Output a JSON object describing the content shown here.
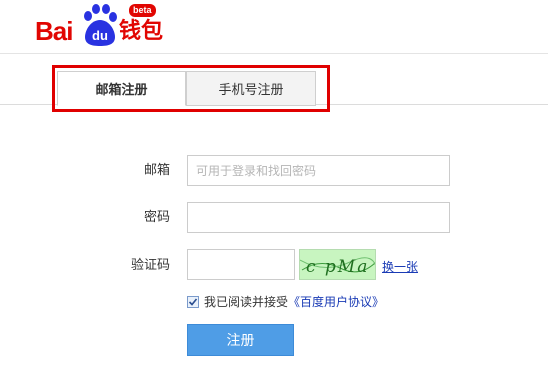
{
  "header": {
    "logo_bai": "Bai",
    "logo_du": "du",
    "logo_wallet": "钱包",
    "logo_beta": "beta"
  },
  "tabs": {
    "email": "邮箱注册",
    "phone": "手机号注册",
    "active": "email"
  },
  "form": {
    "email_label": "邮箱",
    "email_placeholder": "可用于登录和找回密码",
    "email_value": "",
    "password_label": "密码",
    "password_value": "",
    "captcha_label": "验证码",
    "captcha_value": "",
    "captcha_image_text": "c pMa",
    "captcha_refresh": "换一张",
    "agree_checked": true,
    "agree_text": "我已阅读并接受",
    "agree_link": "《百度用户协议》",
    "submit_label": "注册"
  },
  "colors": {
    "brand_red": "#e10602",
    "brand_blue": "#2932e1",
    "highlight": "#e00000",
    "button_blue": "#4f9de6",
    "link_blue": "#1a3bb5"
  }
}
